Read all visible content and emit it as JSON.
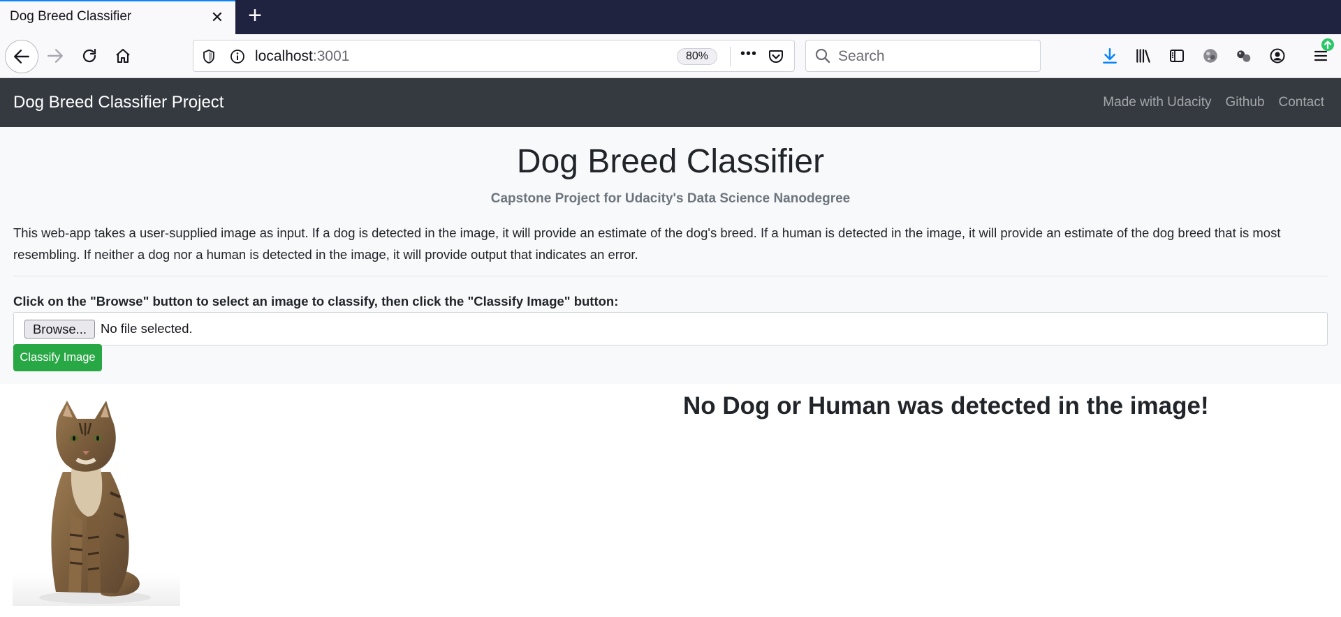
{
  "browser": {
    "tab_title": "Dog Breed Classifier",
    "tab_close": "✕",
    "new_tab": "+",
    "url_host": "localhost",
    "url_port": ":3001",
    "zoom": "80%",
    "search_placeholder": "Search",
    "page_actions": "•••"
  },
  "navbar": {
    "brand": "Dog Breed Classifier Project",
    "links": [
      "Made with Udacity",
      "Github",
      "Contact"
    ]
  },
  "header": {
    "title": "Dog Breed Classifier",
    "subtitle": "Capstone Project for Udacity's Data Science Nanodegree",
    "description": "This web-app takes a user-supplied image as input. If a dog is detected in the image, it will provide an estimate of the dog's breed. If a human is detected in the image, it will provide an estimate of the dog breed that is most resembling. If neither a dog nor a human is detected in the image, it will provide output that indicates an error."
  },
  "form": {
    "instruction": "Click on the \"Browse\" button to select an image to classify, then click the \"Classify Image\" button:",
    "browse_label": "Browse...",
    "file_status": "No file selected.",
    "submit_label": "Classify Image"
  },
  "result": {
    "message": "No Dog or Human was detected in the image!",
    "image_subject": "cat"
  },
  "colors": {
    "navbar_bg": "#343a40",
    "jumbotron_bg": "#f8f9fa",
    "success": "#28a745",
    "tabbar_bg": "#202340",
    "accent_blue": "#0a84ff"
  }
}
